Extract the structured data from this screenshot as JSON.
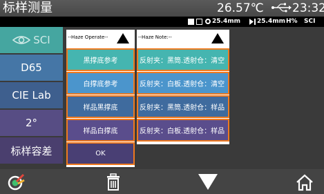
{
  "titlebar": {
    "title": "标样测量",
    "temperature": "26.57℃",
    "time": "23:32"
  },
  "statusbar": {
    "aperture1": "25.4mm",
    "aperture2": "25.4mm",
    "mode1": "H%",
    "mode2": "SCI"
  },
  "sidebar": {
    "items": [
      {
        "label": "SCI",
        "icon": "eye-icon"
      },
      {
        "label": "D65"
      },
      {
        "label": "CIE Lab"
      },
      {
        "label": "2°"
      },
      {
        "label": "标样容差"
      }
    ]
  },
  "haze_operate": {
    "header": "--Haze Operate--",
    "options": [
      "黑撑底参考",
      "白撑底参考",
      "样品黑撑底",
      "样品白撑底",
      "OK"
    ]
  },
  "haze_note": {
    "header": "--Haze Note:--",
    "notes": [
      "反射夹：黑筒.透射仓：清空",
      "反射夹：白板.透射仓：清空",
      "反射夹：黑筒.透射仓：样品",
      "反射夹：白板.透射仓：样品"
    ]
  },
  "bottombar": {
    "icons": [
      "colorimeter-icon",
      "trash-icon",
      "down-arrow-icon",
      "home-icon"
    ]
  }
}
